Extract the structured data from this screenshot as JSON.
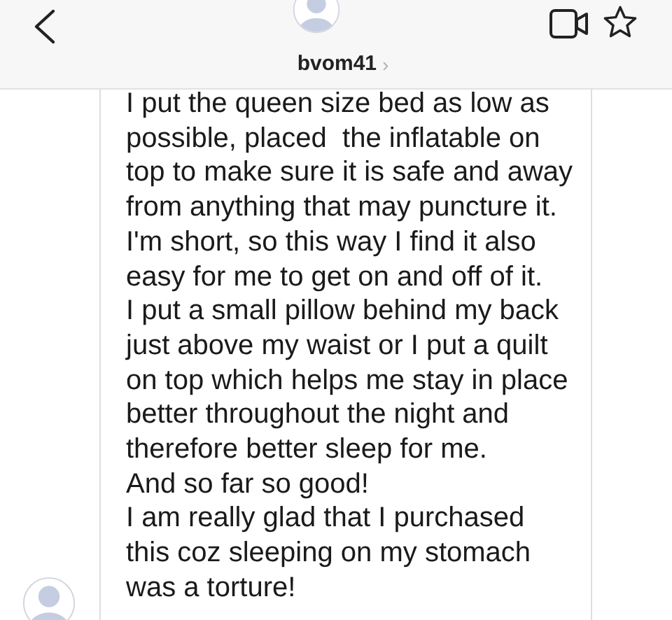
{
  "header": {
    "username": "bvom41",
    "chevron": "›"
  },
  "message": {
    "paragraphs": [
      {
        "lines": [
          "I put the queen size bed as low as",
          "possible, placed  the inflatable on",
          "top to make sure it is safe and away",
          "from anything that may puncture it.",
          "I'm short, so this way I find it also",
          "easy for me to get on and off of it."
        ]
      },
      {
        "lines": [
          "I put a small pillow behind my back",
          "just above my waist or I put a quilt",
          "on top which helps me stay in place",
          "better throughout the night and",
          "therefore better sleep for me."
        ]
      },
      {
        "lines": [
          "And so far so good!"
        ]
      },
      {
        "lines": [
          "I am really glad that I purchased",
          "this coz sleeping on my stomach",
          "was a torture!"
        ]
      }
    ]
  }
}
